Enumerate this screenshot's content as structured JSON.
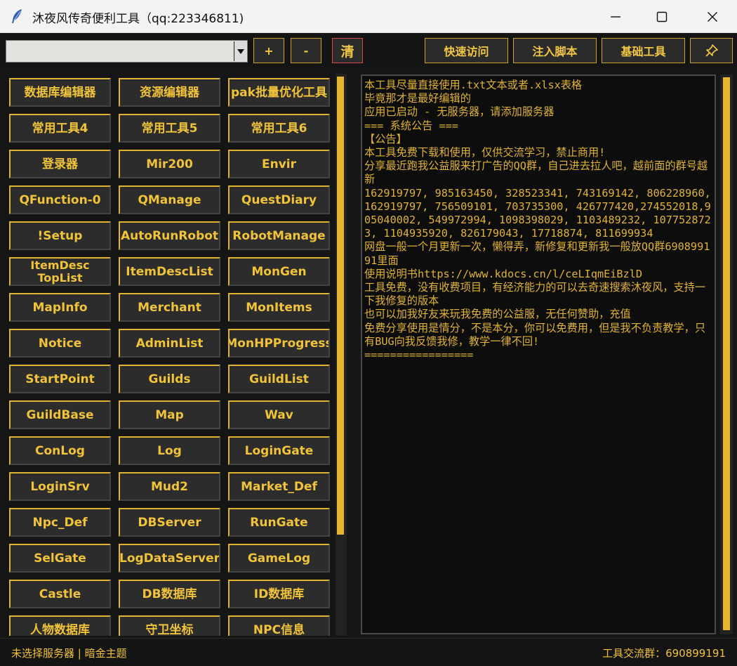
{
  "window": {
    "title": "沐夜风传奇便利工具（qq:223346811)",
    "icon": "feather-icon"
  },
  "toolbar": {
    "server_combo_value": "",
    "add_label": "+",
    "remove_label": "-",
    "clear_label": "清",
    "quick_access_label": "快速访问",
    "inject_script_label": "注入脚本",
    "basic_tools_label": "基础工具",
    "pin_icon": "pin-icon"
  },
  "grid": {
    "buttons": [
      "数据库编辑器",
      "资源编辑器",
      "pak批量优化工具",
      "常用工具4",
      "常用工具5",
      "常用工具6",
      "登录器",
      "Mir200",
      "Envir",
      "QFunction-0",
      "QManage",
      "QuestDiary",
      "!Setup",
      "AutoRunRobot",
      "RobotManage",
      "ItemDesc\nTopList",
      "ItemDescList",
      "MonGen",
      "MapInfo",
      "Merchant",
      "MonItems",
      "Notice",
      "AdminList",
      "MonHPProgress",
      "StartPoint",
      "Guilds",
      "GuildList",
      "GuildBase",
      "Map",
      "Wav",
      "ConLog",
      "Log",
      "LoginGate",
      "LoginSrv",
      "Mud2",
      "Market_Def",
      "Npc_Def",
      "DBServer",
      "RunGate",
      "SelGate",
      "LogDataServer",
      "GameLog",
      "Castle",
      "DB数据库",
      "ID数据库",
      "人物数据库",
      "守卫坐标",
      "NPC信息"
    ]
  },
  "log": {
    "text": "本工具尽量直接使用.txt文本或者.xlsx表格\n毕竟那才是最好编辑的\n应用已启动 - 无服务器，请添加服务器\n=== 系统公告 ===\n【公告】\n本工具免费下载和使用，仅供交流学习，禁止商用!\n分享最近跑我公益服来打广告的QQ群，自己进去拉人吧，越前面的群号越新\n162919797, 985163450, 328523341, 743169142, 806228960, 162919797, 756509101, 703735300, 426777420,274552018,905040002, 549972994, 1098398029, 1103489232, 1077528723, 1104935920, 826179043, 17718874, 811699934\n网盘一般一个月更新一次，懒得弄，新修复和更新我一般放QQ群690899191里面\n使用说明书https://www.kdocs.cn/l/ceLIqmEiBzlD\n工具免费，没有收费项目，有经济能力的可以去奇速搜索沐夜风，支持一下我修复的版本\n也可以加我好友来玩我免费的公益服，无任何赞助，充值\n免费分享使用是情分，不是本分，你可以免费用，但是我不负责教学，只有BUG向我反馈我修，教学一律不回!\n================="
  },
  "status": {
    "left": "未选择服务器 | 暗金主题",
    "right": "工具交流群：690899191"
  },
  "colors": {
    "accent": "#f0c33a",
    "background": "#151515",
    "clear_border": "#d24a4a"
  }
}
